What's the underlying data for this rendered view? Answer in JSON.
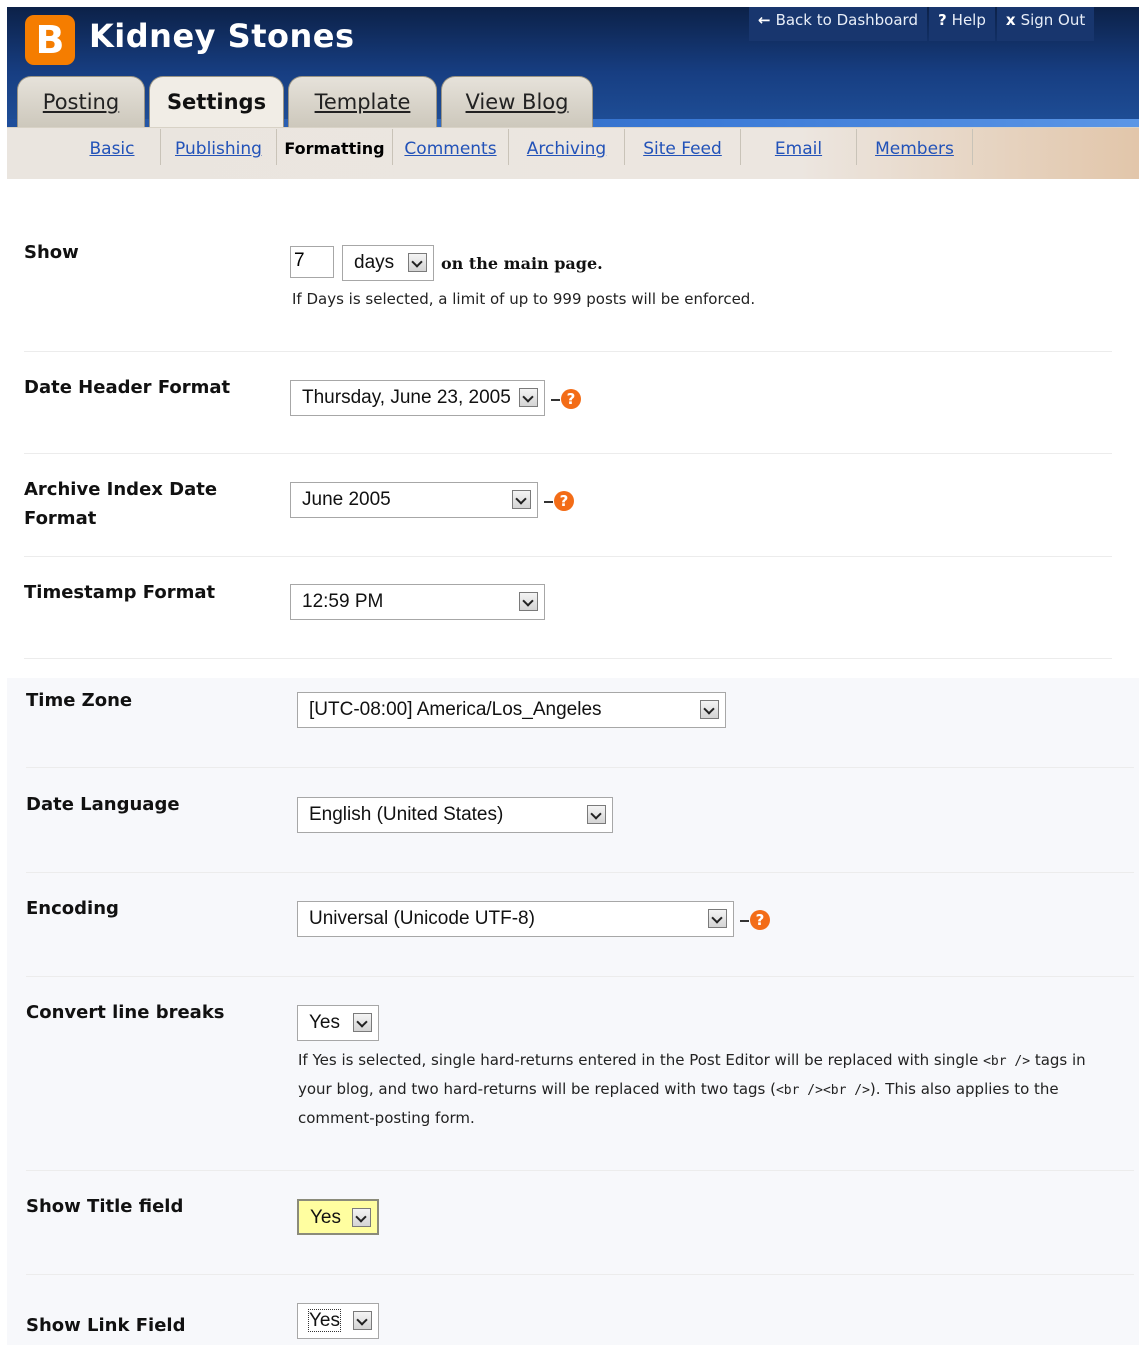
{
  "header": {
    "logo_letter": "B",
    "blog_title": "Kidney Stones",
    "toplinks": [
      {
        "icon": "←",
        "label": "Back to Dashboard"
      },
      {
        "icon": "?",
        "label": "Help"
      },
      {
        "icon": "x",
        "label": "Sign Out"
      }
    ]
  },
  "tabs": [
    {
      "label": "Posting",
      "active": false
    },
    {
      "label": "Settings",
      "active": true
    },
    {
      "label": "Template",
      "active": false
    },
    {
      "label": "View Blog",
      "active": false
    }
  ],
  "subtabs": [
    {
      "label": "Basic"
    },
    {
      "label": "Publishing"
    },
    {
      "label": "Formatting",
      "active": true
    },
    {
      "label": "Comments"
    },
    {
      "label": "Archiving"
    },
    {
      "label": "Site Feed"
    },
    {
      "label": "Email"
    },
    {
      "label": "Members"
    }
  ],
  "form": {
    "show": {
      "label": "Show",
      "count": "7",
      "unit": "days",
      "suffix": "on the main page.",
      "note": "If Days is selected, a limit of up to 999 posts will be enforced."
    },
    "date_header": {
      "label": "Date Header Format",
      "value": "Thursday, June 23, 2005"
    },
    "archive_index": {
      "label_line1": "Archive Index Date",
      "label_line2": "Format",
      "value": "June 2005"
    },
    "timestamp": {
      "label": "Timestamp Format",
      "value": "12:59 PM"
    },
    "time_zone": {
      "label": "Time Zone",
      "value": "[UTC-08:00] America/Los_Angeles"
    },
    "date_language": {
      "label": "Date Language",
      "value": "English (United States)"
    },
    "encoding": {
      "label": "Encoding",
      "value": "Universal (Unicode UTF-8)"
    },
    "convert_line_breaks": {
      "label": "Convert line breaks",
      "value": "Yes",
      "note_line1_a": "If Yes is selected, single hard-returns entered in the Post Editor will be replaced with single ",
      "note_line1_code": "<br />",
      "note_line1_b": " tags in",
      "note_line2_a": "your blog, and two hard-returns will be replaced with two tags (",
      "note_line2_code": "<br /><br />",
      "note_line2_b": "). This also applies to the",
      "note_line3": "comment-posting form."
    },
    "show_title_field": {
      "label": "Show Title field",
      "value": "Yes"
    },
    "show_link_field": {
      "label": "Show Link Field",
      "value": "Yes"
    }
  },
  "help_icon_glyph": "?",
  "colors": {
    "header_blue": "#173e82",
    "logo_orange": "#f57d00",
    "link_blue": "#2252b8",
    "help_orange": "#f36c17",
    "highlight_yellow": "#fffea0"
  }
}
